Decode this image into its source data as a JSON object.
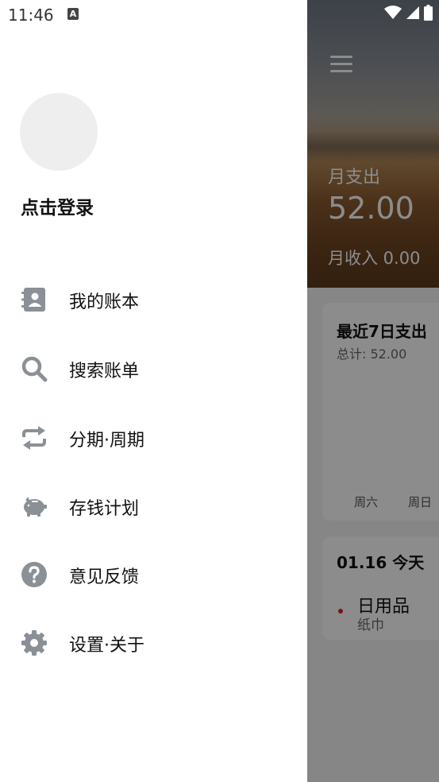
{
  "status_bar": {
    "time": "11:46",
    "notification_icon": "A"
  },
  "drawer": {
    "login_label": "点击登录",
    "menu": [
      {
        "label": "我的账本",
        "icon": "contacts-book-icon"
      },
      {
        "label": "搜索账单",
        "icon": "search-icon"
      },
      {
        "label": "分期·周期",
        "icon": "repeat-icon"
      },
      {
        "label": "存钱计划",
        "icon": "piggy-bank-icon"
      },
      {
        "label": "意见反馈",
        "icon": "help-icon"
      },
      {
        "label": "设置·关于",
        "icon": "gear-icon"
      }
    ],
    "icon_color": "#8a9096"
  },
  "main": {
    "month_expense_label": "月支出",
    "month_expense_value": "52.00",
    "month_income_label": "月收入 0.00",
    "weekly_card": {
      "title": "最近7日支出",
      "total": "总计: 52.00",
      "days": [
        "周六",
        "周日"
      ]
    },
    "day_card": {
      "date": "01.16 今天",
      "category": "日用品",
      "note": "纸巾"
    }
  }
}
